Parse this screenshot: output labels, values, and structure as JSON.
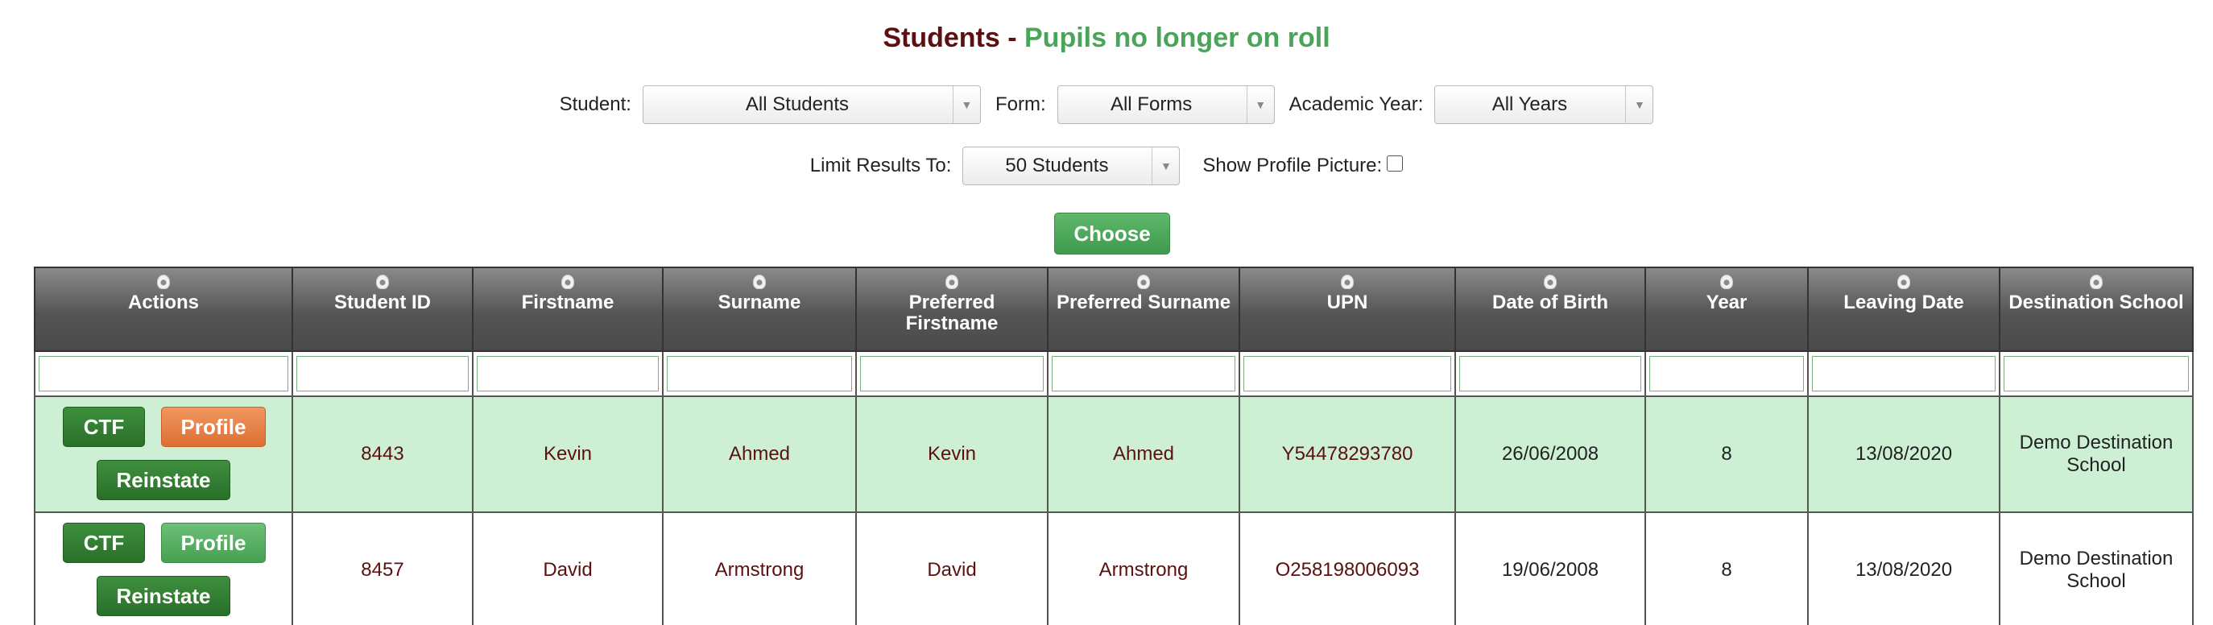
{
  "page": {
    "title_part1": "Students - ",
    "title_part2": "Pupils no longer on roll"
  },
  "filters": {
    "student_label": "Student:",
    "student_value": "All Students",
    "form_label": "Form:",
    "form_value": "All Forms",
    "year_label": "Academic Year:",
    "year_value": "All Years",
    "limit_label": "Limit Results To:",
    "limit_value": "50 Students",
    "picture_label": "Show Profile Picture:",
    "picture_checked": false
  },
  "choose_label": "Choose",
  "table": {
    "columns": [
      "Actions",
      "Student ID",
      "Firstname",
      "Surname",
      "Preferred Firstname",
      "Preferred Surname",
      "UPN",
      "Date of Birth",
      "Year",
      "Leaving Date",
      "Destination School"
    ],
    "actions": {
      "ctf": "CTF",
      "profile": "Profile",
      "reinstate": "Reinstate"
    },
    "rows": [
      {
        "id": "8443",
        "firstname": "Kevin",
        "surname": "Ahmed",
        "pref_first": "Kevin",
        "pref_sur": "Ahmed",
        "upn": "Y54478293780",
        "dob": "26/06/2008",
        "year": "8",
        "leaving": "13/08/2020",
        "destination": "Demo Destination School"
      },
      {
        "id": "8457",
        "firstname": "David",
        "surname": "Armstrong",
        "pref_first": "David",
        "pref_sur": "Armstrong",
        "upn": "O258198006093",
        "dob": "19/06/2008",
        "year": "8",
        "leaving": "13/08/2020",
        "destination": "Demo Destination School"
      }
    ]
  },
  "colors": {
    "title_dark": "#5c1010",
    "title_green": "#4aa45a",
    "row_highlight": "#cdf0d4",
    "profile_orange": "#e8793e",
    "button_green": "#2f7a2f"
  }
}
